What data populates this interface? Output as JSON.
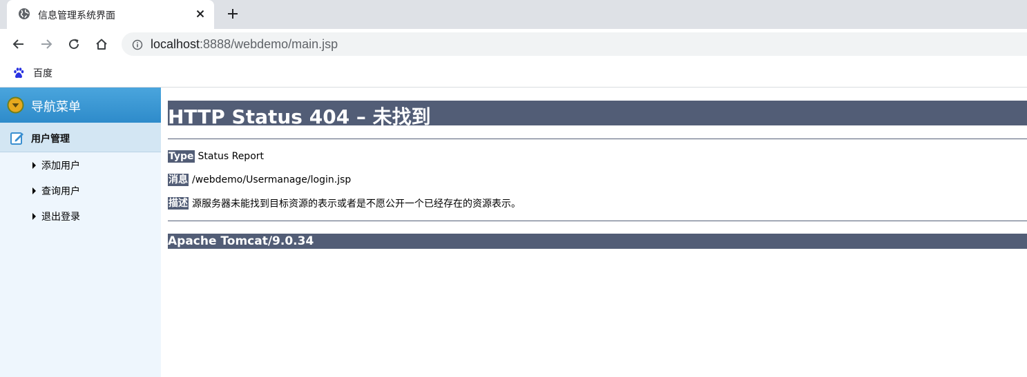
{
  "browser": {
    "tab": {
      "title": "信息管理系统界面",
      "favicon": "globe-icon"
    },
    "url": {
      "host": "localhost",
      "path": ":8888/webdemo/main.jsp"
    },
    "bookmarks": [
      {
        "label": "百度",
        "icon": "baidu-paw-icon"
      }
    ]
  },
  "sidebar": {
    "header": "导航菜单",
    "section": "用户管理",
    "items": [
      {
        "label": "添加用户"
      },
      {
        "label": "查询用户"
      },
      {
        "label": "退出登录"
      }
    ]
  },
  "error_page": {
    "heading": "HTTP Status 404 – 未找到",
    "rows": [
      {
        "key": "Type",
        "value": "Status Report"
      },
      {
        "key": "消息",
        "value": "/webdemo/Usermanage/login.jsp"
      },
      {
        "key": "描述",
        "value": "源服务器未能找到目标资源的表示或者是不愿公开一个已经存在的资源表示。"
      }
    ],
    "footer": "Apache Tomcat/9.0.34"
  },
  "colors": {
    "tomcat_bar": "#525d76",
    "sidebar_header": "#3b97d3",
    "sidebar_bg": "#eef6fd",
    "section_bg": "#d3e6f3"
  }
}
